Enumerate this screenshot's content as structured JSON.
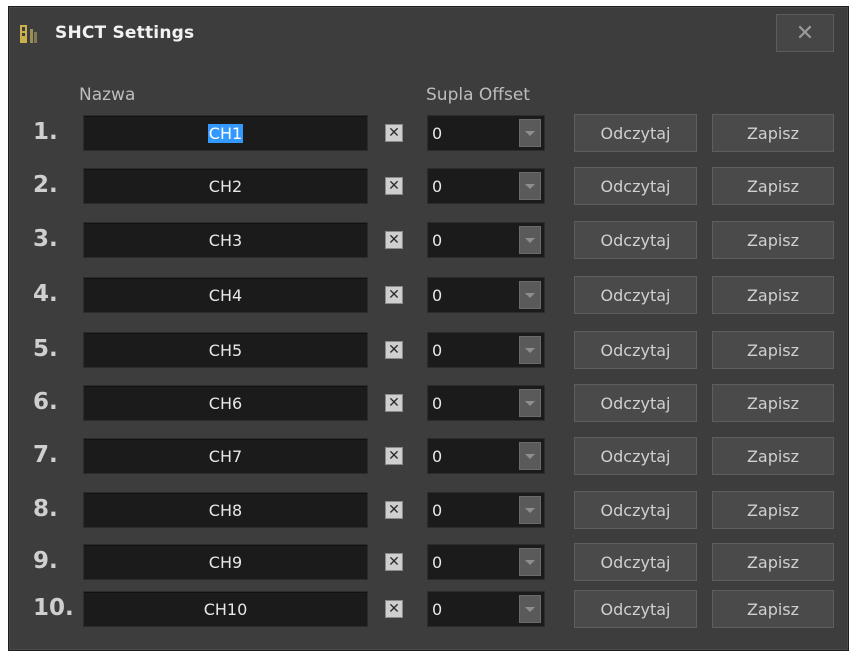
{
  "window": {
    "title": "SHCT Settings",
    "close_label": "✕"
  },
  "headers": {
    "name": "Nazwa",
    "offset": "Supla Offset"
  },
  "rows": [
    {
      "num": "1.",
      "name": "CH1",
      "offset": "0",
      "read": "Odczytaj",
      "save": "Zapisz",
      "selected": true
    },
    {
      "num": "2.",
      "name": "CH2",
      "offset": "0",
      "read": "Odczytaj",
      "save": "Zapisz"
    },
    {
      "num": "3.",
      "name": "CH3",
      "offset": "0",
      "read": "Odczytaj",
      "save": "Zapisz"
    },
    {
      "num": "4.",
      "name": "CH4",
      "offset": "0",
      "read": "Odczytaj",
      "save": "Zapisz"
    },
    {
      "num": "5.",
      "name": "CH5",
      "offset": "0",
      "read": "Odczytaj",
      "save": "Zapisz"
    },
    {
      "num": "6.",
      "name": "CH6",
      "offset": "0",
      "read": "Odczytaj",
      "save": "Zapisz"
    },
    {
      "num": "7.",
      "name": "CH7",
      "offset": "0",
      "read": "Odczytaj",
      "save": "Zapisz"
    },
    {
      "num": "8.",
      "name": "CH8",
      "offset": "0",
      "read": "Odczytaj",
      "save": "Zapisz"
    },
    {
      "num": "9.",
      "name": "CH9",
      "offset": "0",
      "read": "Odczytaj",
      "save": "Zapisz"
    },
    {
      "num": "10.",
      "name": "CH10",
      "offset": "0",
      "read": "Odczytaj",
      "save": "Zapisz"
    }
  ],
  "icons": {
    "app": "shct-app-icon",
    "clear": "clear-x-icon",
    "dropdown": "chevron-down-icon",
    "clear_glyph": "✕"
  },
  "colors": {
    "window_bg": "#3d3d3d",
    "field_bg": "#1b1b1b",
    "button_bg": "#4a4a4a",
    "selection": "#3399ff"
  }
}
